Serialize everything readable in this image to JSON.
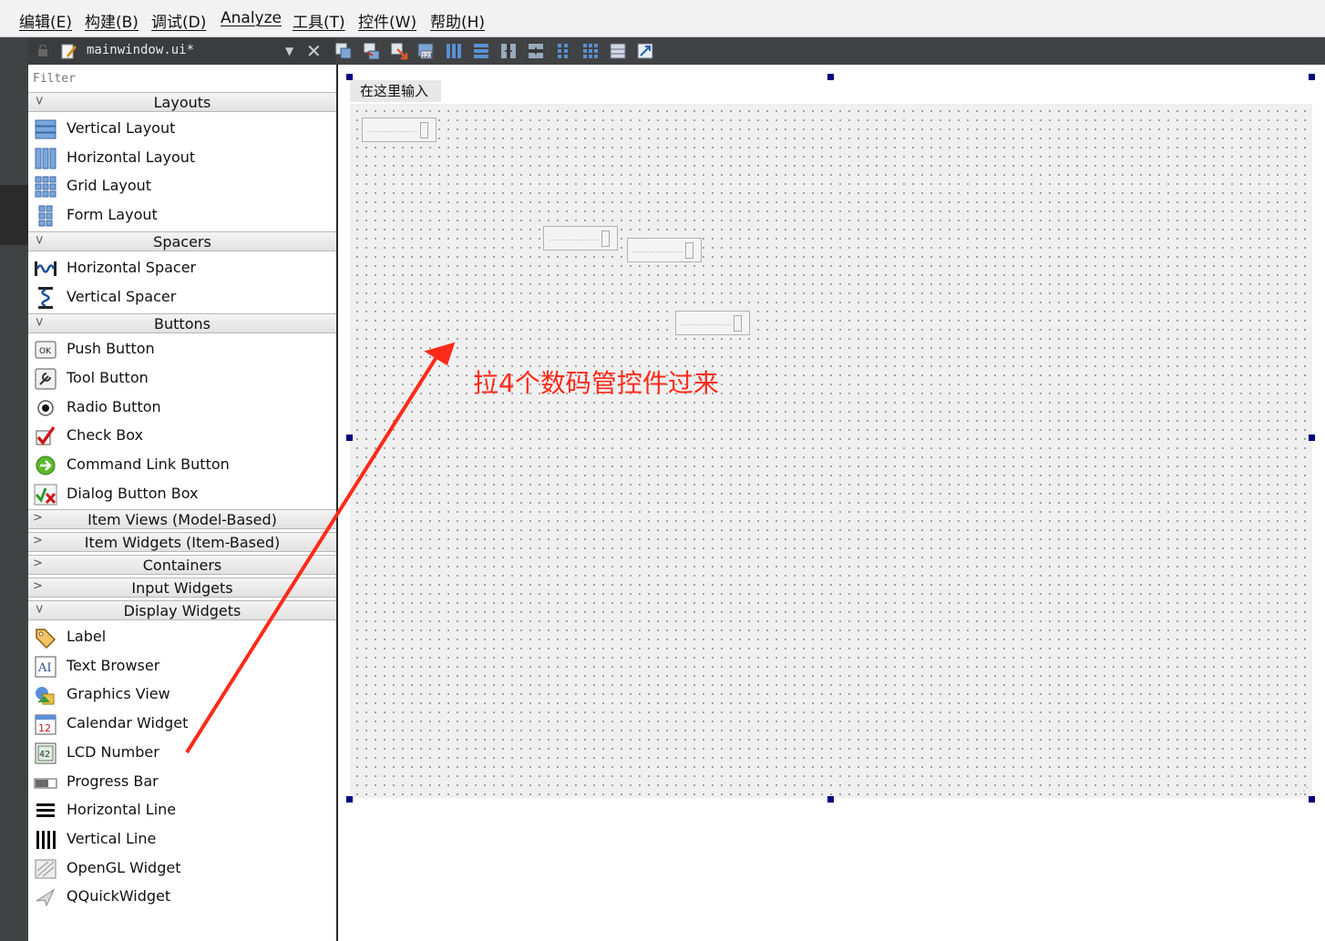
{
  "menubar": {
    "items": [
      {
        "label": "编辑(E)"
      },
      {
        "label": "构建(B)"
      },
      {
        "label": "调试(D)"
      },
      {
        "label": "Analyze"
      },
      {
        "label": "工具(T)"
      },
      {
        "label": "控件(W)"
      },
      {
        "label": "帮助(H)"
      }
    ]
  },
  "toolbar": {
    "file_name": "mainwindow.ui*",
    "close_glyph": "✕",
    "dropdown_glyph": "▼"
  },
  "widget_box": {
    "filter_placeholder": "Filter",
    "categories": {
      "layouts": "Layouts",
      "spacers": "Spacers",
      "buttons": "Buttons",
      "item_views": "Item Views (Model-Based)",
      "item_widgets": "Item Widgets (Item-Based)",
      "containers": "Containers",
      "input_widgets": "Input Widgets",
      "display_widgets": "Display Widgets"
    },
    "layouts": [
      "Vertical Layout",
      "Horizontal Layout",
      "Grid Layout",
      "Form Layout"
    ],
    "spacers": [
      "Horizontal Spacer",
      "Vertical Spacer"
    ],
    "buttons": [
      "Push Button",
      "Tool Button",
      "Radio Button",
      "Check Box",
      "Command Link Button",
      "Dialog Button Box"
    ],
    "display_widgets": [
      "Label",
      "Text Browser",
      "Graphics View",
      "Calendar Widget",
      "LCD Number",
      "Progress Bar",
      "Horizontal Line",
      "Vertical Line",
      "OpenGL Widget",
      "QQuickWidget"
    ]
  },
  "form": {
    "menu_placeholder": "在这里输入",
    "lcd_count": 4
  },
  "annotation": {
    "text": "拉4个数码管控件过来",
    "color": "#ff2a1a"
  },
  "colors": {
    "dark_chrome": "#404244",
    "form_background": "#f0f0f0",
    "selection_handle": "#000080"
  }
}
